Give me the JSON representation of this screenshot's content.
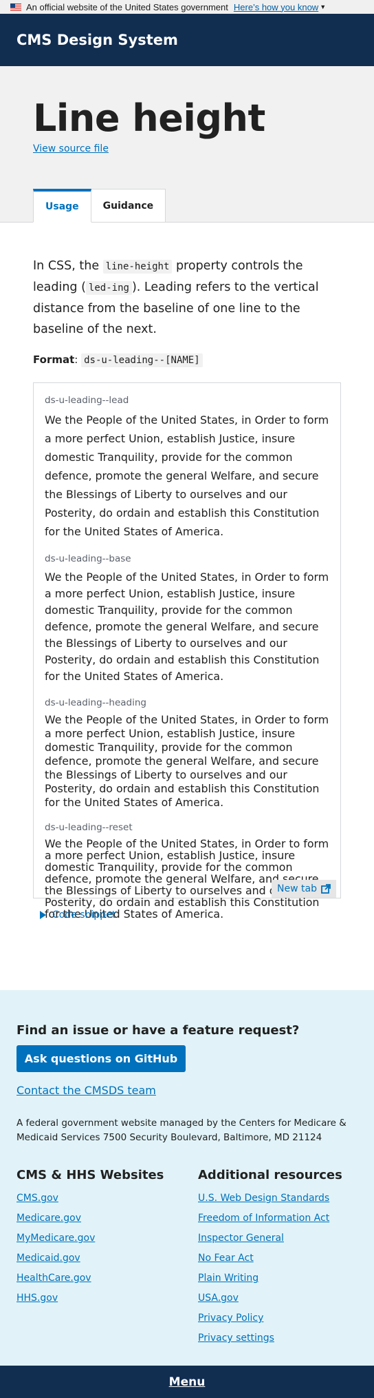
{
  "gov_banner": {
    "text": "An official website of the United States government",
    "link": "Here’s how you know"
  },
  "header": {
    "site_title": "CMS Design System"
  },
  "hero": {
    "title": "Line height",
    "source_link": "View source file",
    "tabs": [
      {
        "label": "Usage",
        "active": true
      },
      {
        "label": "Guidance",
        "active": false
      }
    ]
  },
  "intro": {
    "p1": "In CSS, the ",
    "code1": "line-height",
    "p2": " property controls the leading (",
    "code2": "led-ing",
    "p3": "). Leading refers to the vertical distance from the baseline of one line to the baseline of the next.",
    "format_label": "Format",
    "format_sep": ": ",
    "format_code": "ds-u-leading--[NAME]"
  },
  "examples": [
    {
      "label": "ds-u-leading--lead",
      "text": "We the People of the United States, in Order to form a more perfect Union, establish Justice, insure domestic Tranquility, provide for the common defence, promote the general Welfare, and secure the Blessings of Liberty to ourselves and our Posterity, do ordain and establish this Constitution for the United States of America."
    },
    {
      "label": "ds-u-leading--base",
      "text": "We the People of the United States, in Order to form a more perfect Union, establish Justice, insure domestic Tranquility, provide for the common defence, promote the general Welfare, and secure the Blessings of Liberty to ourselves and our Posterity, do ordain and establish this Constitution for the United States of America."
    },
    {
      "label": "ds-u-leading--heading",
      "text": "We the People of the United States, in Order to form a more perfect Union, establish Justice, insure domestic Tranquility, provide for the common defence, promote the general Welfare, and secure the Blessings of Liberty to ourselves and our Posterity, do ordain and establish this Constitution for the United States of America."
    },
    {
      "label": "ds-u-leading--reset",
      "text": "We the People of the United States, in Order to form a more perfect Union, establish Justice, insure domestic Tranquility, provide for the common defence, promote the general Welfare, and secure the Blessings of Liberty to ourselves and our Posterity, do ordain and establish this Constitution for the United States of America."
    }
  ],
  "new_tab": {
    "label": "New tab",
    "icon": "external-link-icon"
  },
  "code_snippet": {
    "label": "Code snippet",
    "icon": "triangle-right-icon"
  },
  "footer": {
    "heading": "Find an issue or have a feature request?",
    "github_button": "Ask questions on GitHub",
    "contact_link": "Contact the CMSDS team",
    "fed_text": "A federal government website managed by the Centers for Medicare & Medicaid Services 7500 Security Boulevard, Baltimore, MD 21124",
    "col1": {
      "title": "CMS & HHS Websites",
      "links": [
        "CMS.gov",
        "Medicare.gov",
        "MyMedicare.gov",
        "Medicaid.gov",
        "HealthCare.gov",
        "HHS.gov"
      ]
    },
    "col2": {
      "title": "Additional resources",
      "links": [
        "U.S. Web Design Standards",
        "Freedom of Information Act",
        "Inspector General",
        "No Fear Act",
        "Plain Writing",
        "USA.gov",
        "Privacy Policy",
        "Privacy settings"
      ]
    }
  },
  "menu": {
    "label": "Menu"
  },
  "colors": {
    "primary": "#0071bc",
    "header_bg": "#112e51",
    "footer_bg": "#e1f3f8",
    "hero_bg": "#f1f1f1"
  }
}
